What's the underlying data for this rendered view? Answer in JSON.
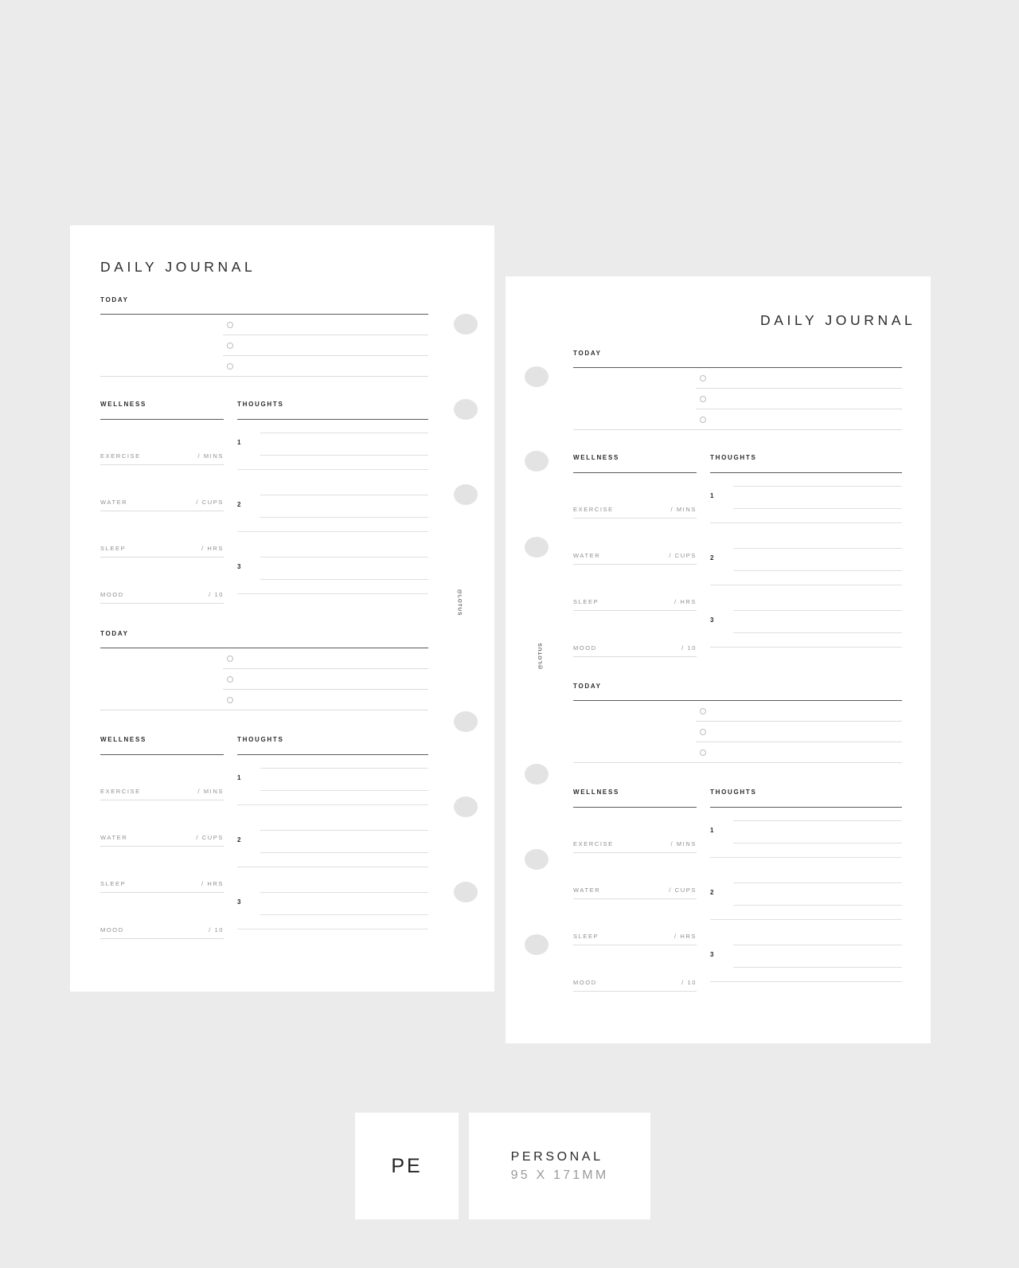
{
  "canvas": {
    "background_color": "#ebebeb"
  },
  "pages": [
    {
      "id": "page-left",
      "title": "DAILY JOURNAL",
      "watermark": "@LOTUS",
      "sections": [
        {
          "today_label": "TODAY",
          "wellness_label": "WELLNESS",
          "thoughts_label": "THOUGHTS",
          "checkbox_count": 3,
          "metrics": [
            {
              "name": "EXERCISE",
              "unit": "/ MINS"
            },
            {
              "name": "WATER",
              "unit": "/ CUPS"
            },
            {
              "name": "SLEEP",
              "unit": "/ HRS"
            },
            {
              "name": "MOOD",
              "unit": "/ 10"
            }
          ],
          "thoughts": [
            "1",
            "2",
            "3"
          ]
        },
        {
          "today_label": "TODAY",
          "wellness_label": "WELLNESS",
          "thoughts_label": "THOUGHTS",
          "checkbox_count": 3,
          "metrics": [
            {
              "name": "EXERCISE",
              "unit": "/ MINS"
            },
            {
              "name": "WATER",
              "unit": "/ CUPS"
            },
            {
              "name": "SLEEP",
              "unit": "/ HRS"
            },
            {
              "name": "MOOD",
              "unit": "/ 10"
            }
          ],
          "thoughts": [
            "1",
            "2",
            "3"
          ]
        }
      ]
    },
    {
      "id": "page-right",
      "title": "DAILY JOURNAL",
      "watermark": "@LOTUS",
      "sections": [
        {
          "today_label": "TODAY",
          "wellness_label": "WELLNESS",
          "thoughts_label": "THOUGHTS",
          "checkbox_count": 3,
          "metrics": [
            {
              "name": "EXERCISE",
              "unit": "/ MINS"
            },
            {
              "name": "WATER",
              "unit": "/ CUPS"
            },
            {
              "name": "SLEEP",
              "unit": "/ HRS"
            },
            {
              "name": "MOOD",
              "unit": "/ 10"
            }
          ],
          "thoughts": [
            "1",
            "2",
            "3"
          ]
        },
        {
          "today_label": "TODAY",
          "wellness_label": "WELLNESS",
          "thoughts_label": "THOUGHTS",
          "checkbox_count": 3,
          "metrics": [
            {
              "name": "EXERCISE",
              "unit": "/ MINS"
            },
            {
              "name": "WATER",
              "unit": "/ CUPS"
            },
            {
              "name": "SLEEP",
              "unit": "/ HRS"
            },
            {
              "name": "MOOD",
              "unit": "/ 10"
            }
          ],
          "thoughts": [
            "1",
            "2",
            "3"
          ]
        }
      ]
    }
  ],
  "footer": {
    "code": "PE",
    "name": "PERSONAL",
    "size": "95 X 171MM"
  },
  "colors": {
    "page": "#ffffff",
    "background": "#ebebeb",
    "ring_hole": "#e3e3e3",
    "rule_dark": "#5a5a5a",
    "rule_light": "#dddddd",
    "text_dark": "#2b2b2b",
    "text_muted": "#8f8f8f"
  }
}
